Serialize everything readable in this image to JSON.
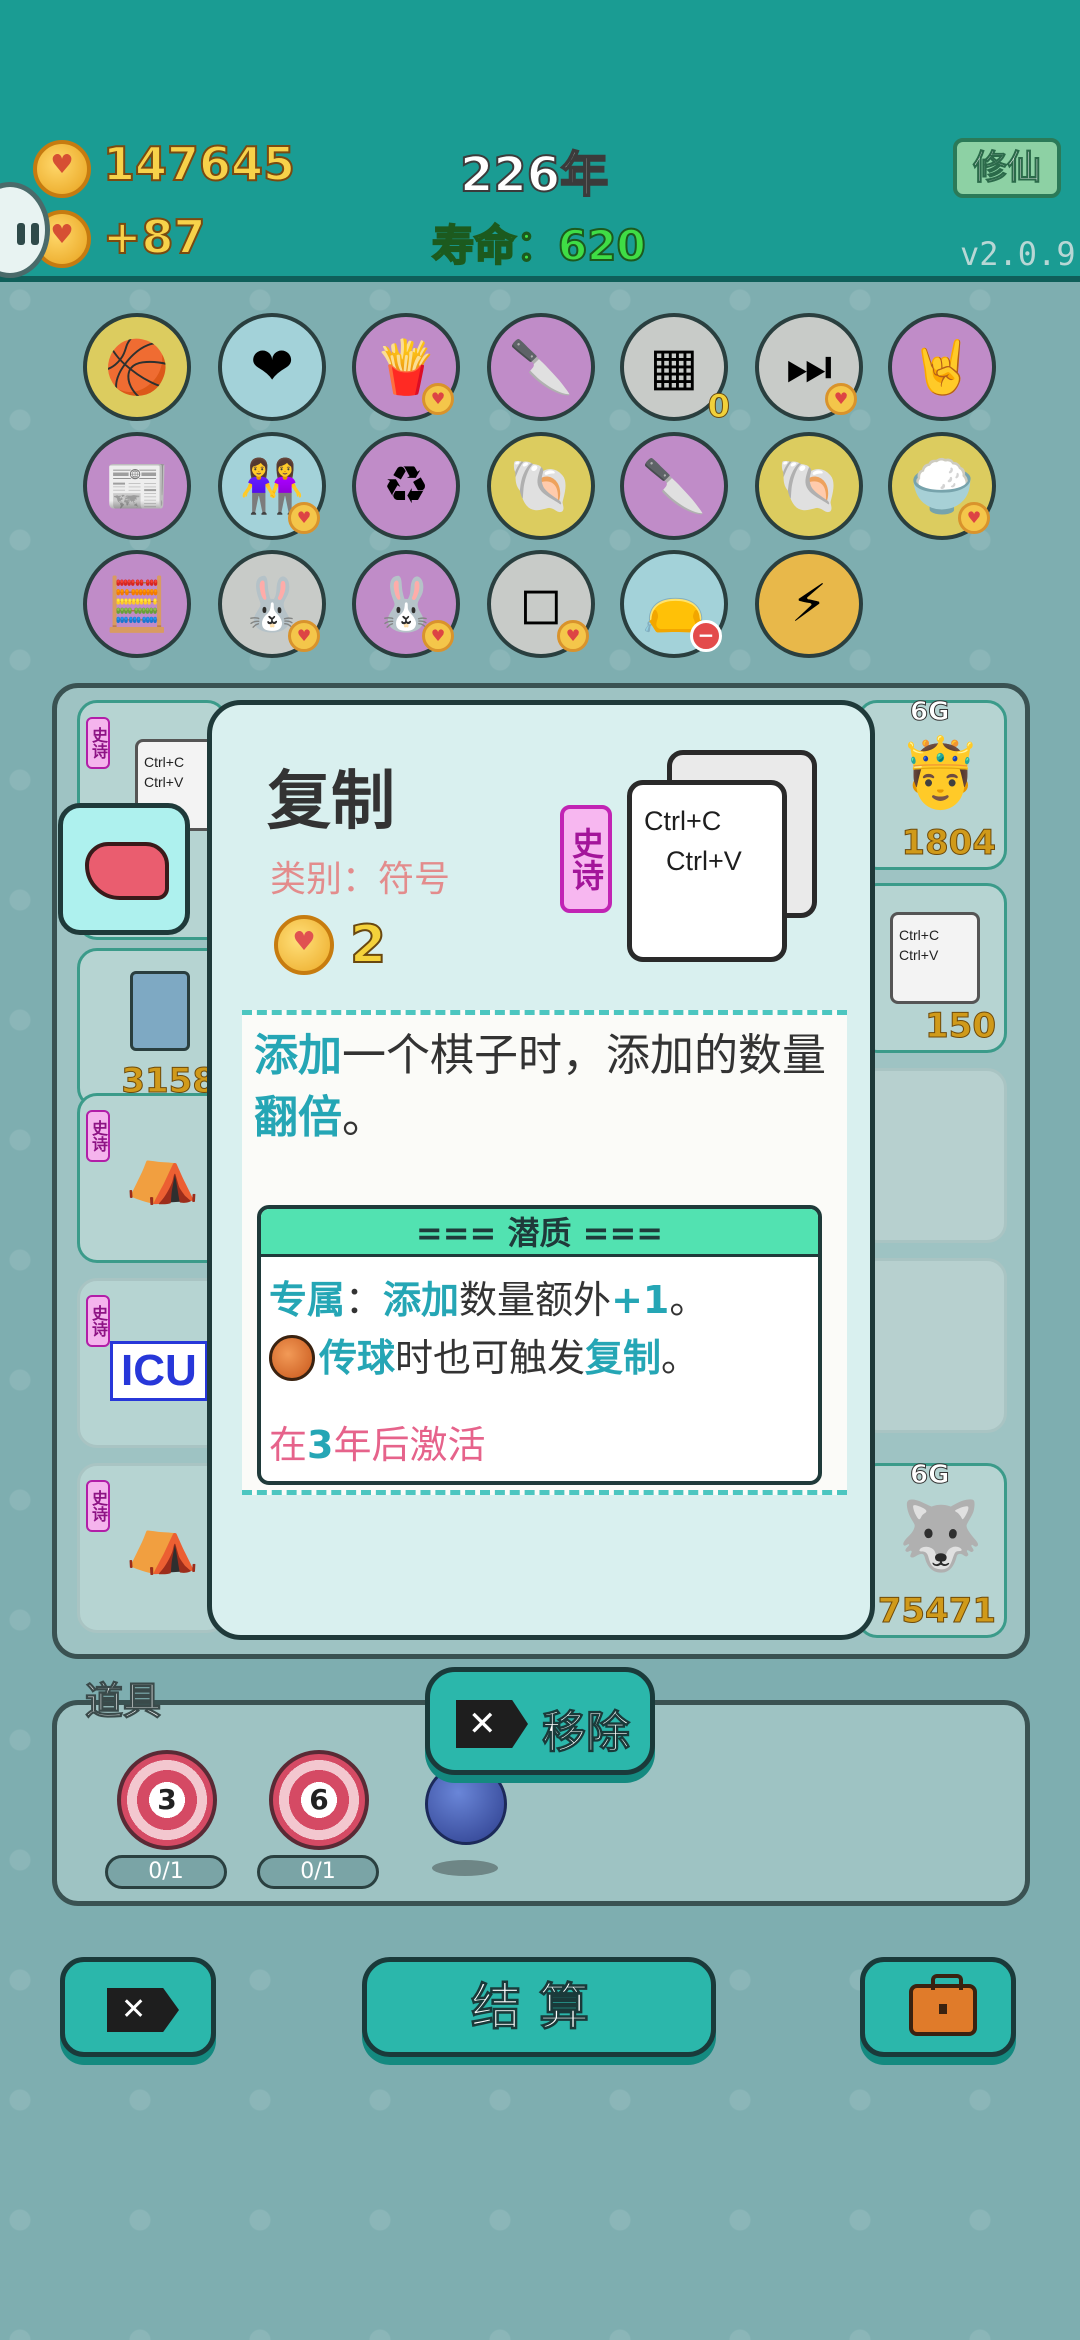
{
  "header": {
    "coins": "147645",
    "coin_gain": "+87",
    "year": "226年",
    "lifespan": "寿命：620",
    "cultivate_button": "修仙",
    "version": "v2.0.9"
  },
  "items_grid": {
    "row1": [
      {
        "icon": "basketballs-icon"
      },
      {
        "icon": "blood-bag-icon"
      },
      {
        "icon": "fries-icon"
      },
      {
        "icon": "cleaver-icon"
      },
      {
        "icon": "egg-tray-icon",
        "count": "0"
      },
      {
        "icon": "skip-icon"
      },
      {
        "icon": "rock-hand-icon"
      }
    ],
    "row2": [
      {
        "icon": "time-magazine-icon"
      },
      {
        "icon": "twins-icon"
      },
      {
        "icon": "recycle-icon"
      },
      {
        "icon": "shell-icon"
      },
      {
        "icon": "cleaver-icon"
      },
      {
        "icon": "shell-icon"
      },
      {
        "icon": "rice-bowl-icon"
      }
    ],
    "row3": [
      {
        "icon": "math-head-icon"
      },
      {
        "icon": "rabbit-icon"
      },
      {
        "icon": "rabbit-icon"
      },
      {
        "icon": "sugar-cubes-icon"
      },
      {
        "icon": "sack-icon"
      },
      {
        "icon": "lightning-icon"
      }
    ]
  },
  "board": {
    "epic_tag": "史诗",
    "mini_card_line1": "Ctrl+C",
    "mini_card_line2": "Ctrl+V",
    "values": [
      "1804",
      "150",
      "3158",
      "75471"
    ],
    "six_g": "6G",
    "icu": "ICU"
  },
  "detail": {
    "title": "复制",
    "category": "类别：符号",
    "cost": "2",
    "rarity": "史诗",
    "card_line1": "Ctrl+C",
    "card_line2": "Ctrl+V",
    "desc_hl1": "添加",
    "desc_part1": "一个棋子时，添加的数量",
    "desc_hl2": "翻倍",
    "desc_part2": "。",
    "potential_title": "=== 潜质 ===",
    "pot1_hl1": "专属",
    "pot1_part1": "：",
    "pot1_hl2": "添加",
    "pot1_part2": "数量额外",
    "pot1_hl3": "+1",
    "pot1_part3": "。",
    "pot2_hl1": "传球",
    "pot2_part1": "时也可触发",
    "pot2_hl2": "复制",
    "pot2_part2": "。",
    "activate_pre": "在",
    "activate_num": "3",
    "activate_post": "年后激活"
  },
  "remove_button": "移除",
  "tools": {
    "label": "道具",
    "items": [
      {
        "value": "3",
        "uses": "0/1"
      },
      {
        "value": "6",
        "uses": "0/1"
      }
    ]
  },
  "bottom": {
    "settle_button": "结算"
  }
}
